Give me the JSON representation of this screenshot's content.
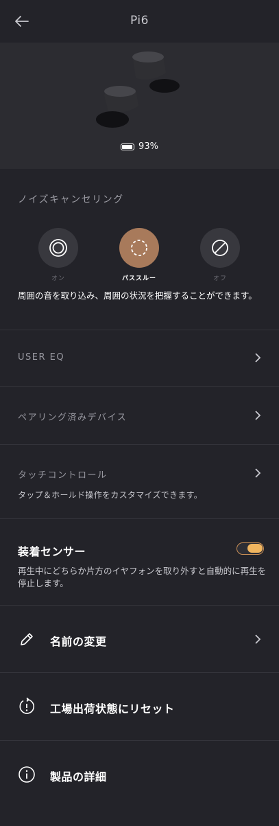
{
  "header": {
    "title": "Pi6",
    "back_icon": "arrow-left-icon"
  },
  "device": {
    "battery_text": "93%",
    "battery_level": 93,
    "image": "earbuds-image"
  },
  "anc": {
    "label": "ノイズキャンセリング",
    "modes": [
      {
        "label": "オン",
        "icon": "anc-on-icon",
        "active": false
      },
      {
        "label": "パススルー",
        "icon": "passthrough-icon",
        "active": true
      },
      {
        "label": "オフ",
        "icon": "off-slash-icon",
        "active": false
      }
    ],
    "description": "周囲の音を取り込み、周囲の状況を把握することができます。"
  },
  "user_eq": {
    "label": "USER EQ"
  },
  "paired": {
    "label": "ペアリング済みデバイス"
  },
  "touch": {
    "label": "タッチコントロール",
    "description": "タップ＆ホールド操作をカスタマイズできます。"
  },
  "sensor": {
    "title": "装着センサー",
    "enabled": true,
    "description": "再生中にどちらか片方のイヤフォンを取り外すと自動的に再生を停止します。"
  },
  "rename": {
    "label": "名前の変更",
    "icon": "pencil-icon"
  },
  "reset": {
    "label": "工場出荷状態にリセット",
    "icon": "reset-icon"
  },
  "details": {
    "label": "製品の詳細",
    "icon": "info-icon"
  },
  "colors": {
    "background": "#232329",
    "hero": "#2c2c31",
    "accent": "#a87a5b",
    "toggle": "#f2b65f"
  }
}
